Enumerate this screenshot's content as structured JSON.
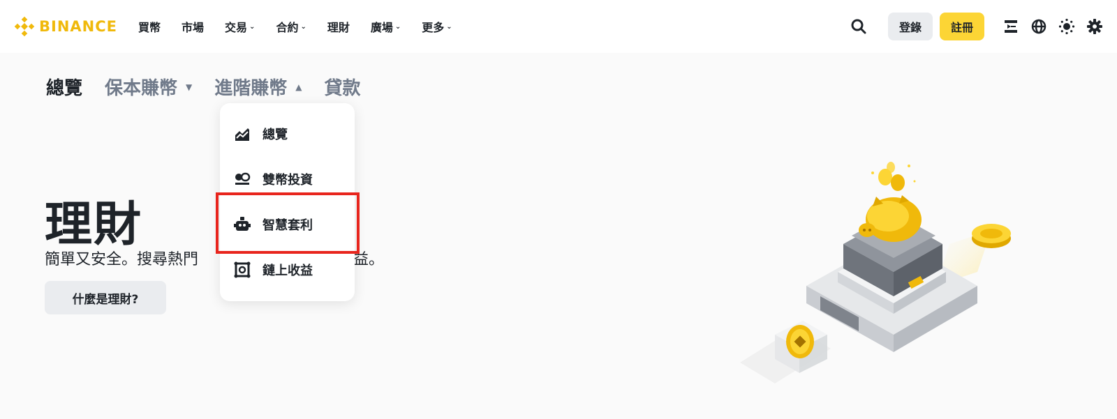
{
  "brand": {
    "name": "BINANCE",
    "color": "#f0b90b"
  },
  "nav": {
    "items": [
      {
        "label": "買幣",
        "has_dropdown": false
      },
      {
        "label": "市場",
        "has_dropdown": false
      },
      {
        "label": "交易",
        "has_dropdown": true
      },
      {
        "label": "合約",
        "has_dropdown": true
      },
      {
        "label": "理財",
        "has_dropdown": false
      },
      {
        "label": "廣場",
        "has_dropdown": true
      },
      {
        "label": "更多",
        "has_dropdown": true
      }
    ],
    "login_label": "登錄",
    "register_label": "註冊",
    "icons": [
      "search-icon",
      "download-icon",
      "globe-icon",
      "theme-icon",
      "settings-icon"
    ]
  },
  "subtabs": [
    {
      "label": "總覽",
      "active": true,
      "arrow": ""
    },
    {
      "label": "保本賺幣",
      "active": false,
      "arrow": "down"
    },
    {
      "label": "進階賺幣",
      "active": false,
      "arrow": "up"
    },
    {
      "label": "貸款",
      "active": false,
      "arrow": ""
    }
  ],
  "dropdown": {
    "items": [
      {
        "label": "總覽",
        "icon": "chart-overview-icon"
      },
      {
        "label": "雙幣投資",
        "icon": "dual-coin-icon"
      },
      {
        "label": "智慧套利",
        "icon": "robot-icon",
        "highlighted": true
      },
      {
        "label": "鏈上收益",
        "icon": "onchain-icon"
      }
    ]
  },
  "hero": {
    "title": "理財",
    "subtitle_left": "簡單又安全。搜尋熱門",
    "subtitle_right": "益。",
    "button_label": "什麼是理財?"
  },
  "colors": {
    "accent": "#fcd535",
    "highlight": "#e8251d",
    "text": "#1e2329",
    "muted": "#707a8a"
  }
}
